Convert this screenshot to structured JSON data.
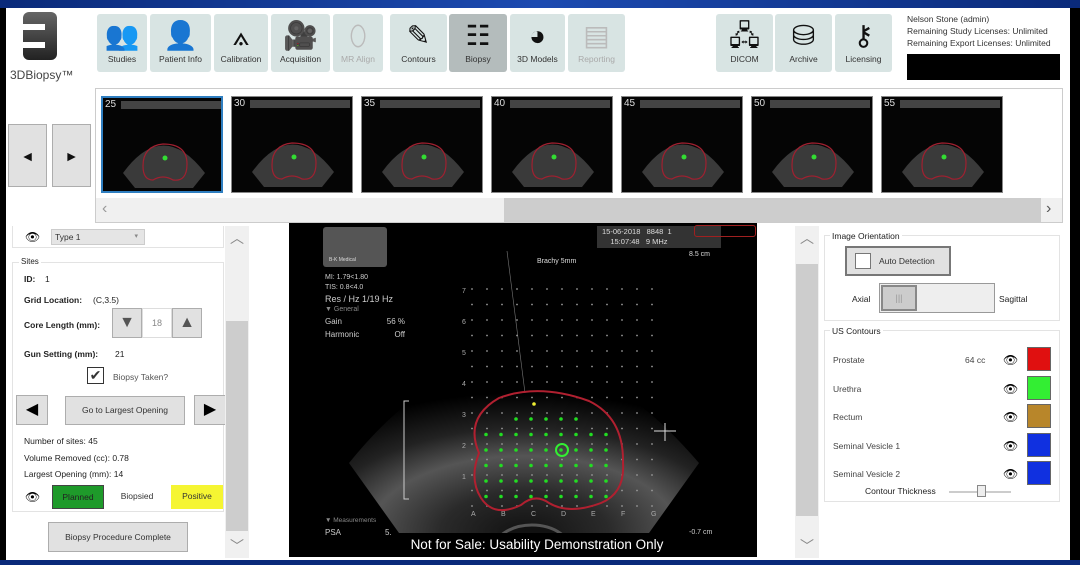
{
  "app": {
    "logo_text": "3DBiopsy™"
  },
  "toolbar": {
    "items": [
      {
        "label": "Studies",
        "icon": "users-icon",
        "state": "normal"
      },
      {
        "label": "Patient Info",
        "icon": "person-icon",
        "state": "normal"
      },
      {
        "label": "Calibration",
        "icon": "compass-icon",
        "state": "normal"
      },
      {
        "label": "Acquisition",
        "icon": "camera-icon",
        "state": "normal"
      },
      {
        "label": "MR Align",
        "icon": "mr-align-icon",
        "state": "disabled"
      },
      {
        "label": "Contours",
        "icon": "pen-icon",
        "state": "normal"
      },
      {
        "label": "Biopsy",
        "icon": "biopsy-icon",
        "state": "active"
      },
      {
        "label": "3D Models",
        "icon": "globe-icon",
        "state": "normal"
      },
      {
        "label": "Reporting",
        "icon": "report-icon",
        "state": "disabled"
      }
    ],
    "right_items": [
      {
        "label": "DICOM",
        "icon": "network-icon"
      },
      {
        "label": "Archive",
        "icon": "database-icon"
      },
      {
        "label": "Licensing",
        "icon": "key-icon"
      }
    ]
  },
  "user": {
    "name": "Nelson Stone (admin)",
    "study_licenses": "Remaining Study Licenses: Unlimited",
    "export_licenses": "Remaining Export Licenses: Unlimited"
  },
  "thumbnails": [
    "25",
    "30",
    "35",
    "40",
    "45",
    "50",
    "55"
  ],
  "left_panel": {
    "type_select": "Type 1",
    "sites_title": "Sites",
    "id_label": "ID:",
    "id_value": "1",
    "grid_label": "Grid Location:",
    "grid_value": "(C,3.5)",
    "core_label": "Core Length (mm):",
    "core_value": "18",
    "gun_label": "Gun Setting (mm):",
    "gun_value": "21",
    "biopsy_taken": "Biopsy Taken?",
    "biopsy_taken_checked": true,
    "goto_largest": "Go to Largest Opening",
    "num_sites": "Number of sites: 45",
    "volume_removed": "Volume Removed (cc): 0.78",
    "largest_opening": "Largest Opening (mm): 14",
    "legend": [
      {
        "label": "Planned",
        "color": "#1e9a2a"
      },
      {
        "label": "Biopsied",
        "color": "#ffffff"
      },
      {
        "label": "Positive",
        "color": "#f5f532"
      }
    ],
    "complete_button": "Biopsy Procedure Complete"
  },
  "ultrasound": {
    "brand": "B-K Medical",
    "date": "15-06-2018",
    "code": "8848",
    "frame": "1",
    "time": "15:07:48",
    "freq": "9 MHz",
    "depth": "8.5 cm",
    "depth_bottom": "-0.7 cm",
    "needle": "Brachy 5mm",
    "mi": "MI:    1.79<1.80",
    "tis": "TIS:   0.8<4.0",
    "res": "Res / Hz    1/19 Hz",
    "general": "▼ General",
    "gain_label": "Gain",
    "gain_value": "56 %",
    "harmonic_label": "Harmonic",
    "harmonic_value": "Off",
    "measurements": "▼ Measurements",
    "psa_label": "PSA",
    "psa_value": "5.",
    "row_labels": [
      "7",
      "6",
      "5",
      "4",
      "3",
      "2",
      "1"
    ],
    "col_labels": [
      "A",
      "B",
      "C",
      "D",
      "E",
      "F",
      "G"
    ],
    "watermark": "Not for Sale: Usability Demonstration Only"
  },
  "right_panel": {
    "orientation_title": "Image Orientation",
    "auto_detection": "Auto Detection",
    "axial": "Axial",
    "sagittal": "Sagittal",
    "contours_title": "US Contours",
    "contours": [
      {
        "name": "Prostate",
        "volume": "64 cc",
        "color": "#e01010"
      },
      {
        "name": "Urethra",
        "volume": "",
        "color": "#33ee33"
      },
      {
        "name": "Rectum",
        "volume": "",
        "color": "#b8862a"
      },
      {
        "name": "Seminal Vesicle 1",
        "volume": "",
        "color": "#1030e0"
      },
      {
        "name": "Seminal Vesicle 2",
        "volume": "",
        "color": "#1030e0"
      }
    ],
    "thickness_label": "Contour Thickness"
  }
}
